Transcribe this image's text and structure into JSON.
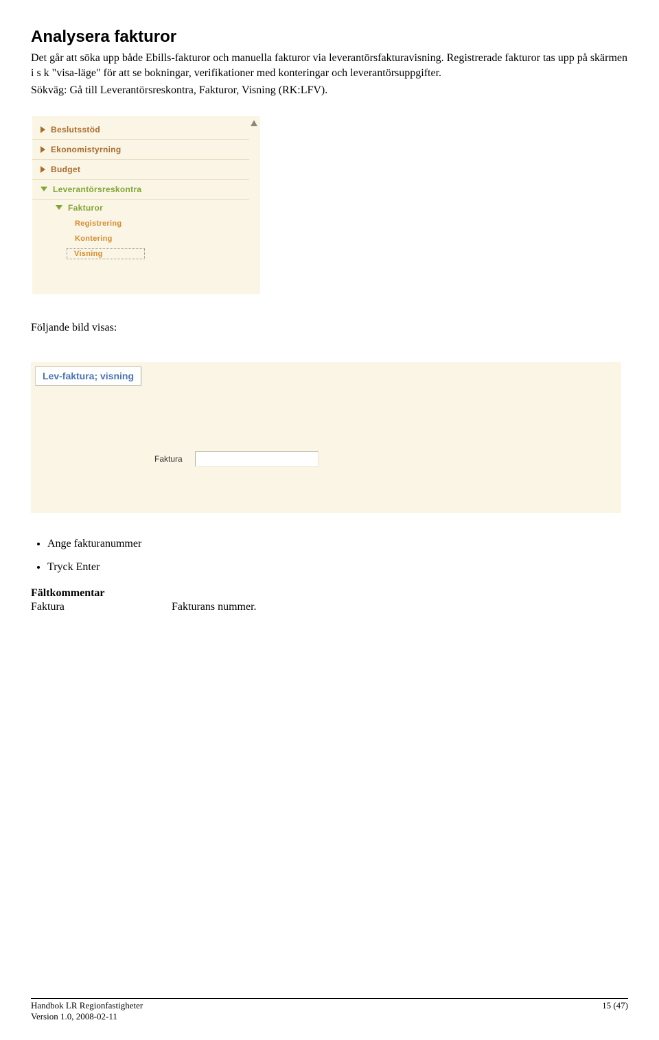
{
  "heading": "Analysera fakturor",
  "para1": "Det går att söka upp både Ebills-fakturor och manuella fakturor via leverantörsfakturavisning. Registrerade fakturor tas upp på skärmen i s k \"visa-läge\" för att se bokningar, verifikationer med konteringar och leverantörsuppgifter.",
  "para2": "Sökväg: Gå till Leverantörsreskontra, Fakturor, Visning (RK:LFV).",
  "nav": {
    "items": [
      {
        "label": "Beslutsstöd",
        "kind": "closed"
      },
      {
        "label": "Ekonomistyrning",
        "kind": "closed"
      },
      {
        "label": "Budget",
        "kind": "closed"
      },
      {
        "label": "Leverantörsreskontra",
        "kind": "open"
      }
    ],
    "sub1": {
      "label": "Fakturor"
    },
    "sub2": [
      {
        "label": "Registrering"
      },
      {
        "label": "Kontering"
      },
      {
        "label": "Visning",
        "selected": true
      }
    ]
  },
  "mid_text": "Följande bild visas:",
  "form": {
    "tab": "Lev-faktura; visning",
    "field_label": "Faktura",
    "field_value": ""
  },
  "bullets": [
    "Ange fakturanummer",
    "Tryck Enter"
  ],
  "faltkommentar": {
    "title": "Fältkommentar",
    "col1": "Faktura",
    "col2": "Fakturans nummer."
  },
  "footer": {
    "left1": "Handbok LR Regionfastigheter",
    "right1": "15 (47)",
    "left2": "Version 1.0, 2008-02-11"
  }
}
